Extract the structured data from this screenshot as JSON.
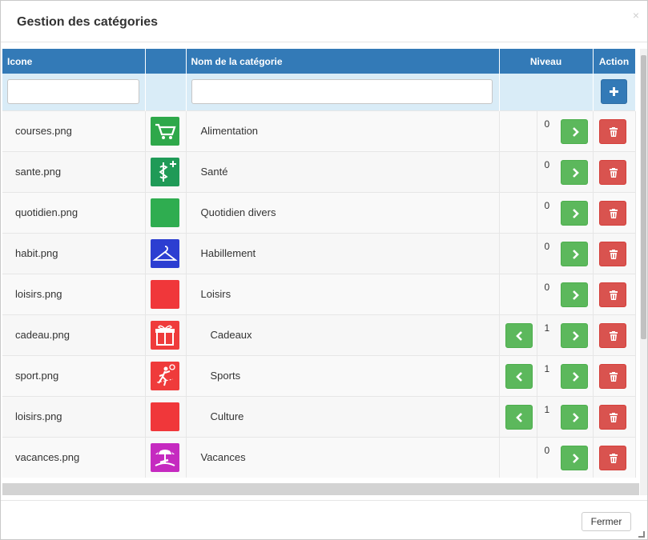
{
  "modal": {
    "title": "Gestion des catégories",
    "close_symbol": "×"
  },
  "table": {
    "headers": {
      "icon": "Icone",
      "blank": "",
      "name": "Nom de la catégorie",
      "level": "Niveau",
      "action": "Action"
    },
    "rows": [
      {
        "file": "courses.png",
        "name": "Alimentation",
        "level": "0",
        "icon": "cart-icon",
        "color": "#2ea84a",
        "child": false
      },
      {
        "file": "sante.png",
        "name": "Santé",
        "level": "0",
        "icon": "health-icon",
        "color": "#1f9a57",
        "child": false
      },
      {
        "file": "quotidien.png",
        "name": "Quotidien divers",
        "level": "0",
        "icon": "blank-green-icon",
        "color": "#2fad50",
        "child": false
      },
      {
        "file": "habit.png",
        "name": "Habillement",
        "level": "0",
        "icon": "hanger-icon",
        "color": "#2c3ed1",
        "child": false
      },
      {
        "file": "loisirs.png",
        "name": "Loisirs",
        "level": "0",
        "icon": "blank-red-icon",
        "color": "#f0373a",
        "child": false
      },
      {
        "file": "cadeau.png",
        "name": "Cadeaux",
        "level": "1",
        "icon": "gift-icon",
        "color": "#ef3b3b",
        "child": true
      },
      {
        "file": "sport.png",
        "name": "Sports",
        "level": "1",
        "icon": "sport-icon",
        "color": "#ef3b3b",
        "child": true
      },
      {
        "file": "loisirs.png",
        "name": "Culture",
        "level": "1",
        "icon": "blank-red-icon",
        "color": "#f0373a",
        "child": true
      },
      {
        "file": "vacances.png",
        "name": "Vacances",
        "level": "0",
        "icon": "beach-icon",
        "color": "#c52ac0",
        "child": false
      }
    ]
  },
  "footer": {
    "close_label": "Fermer"
  },
  "colors": {
    "header_blue": "#337ab7",
    "filter_bg": "#d9ecf7",
    "green": "#5cb85c",
    "red": "#d9534f"
  }
}
